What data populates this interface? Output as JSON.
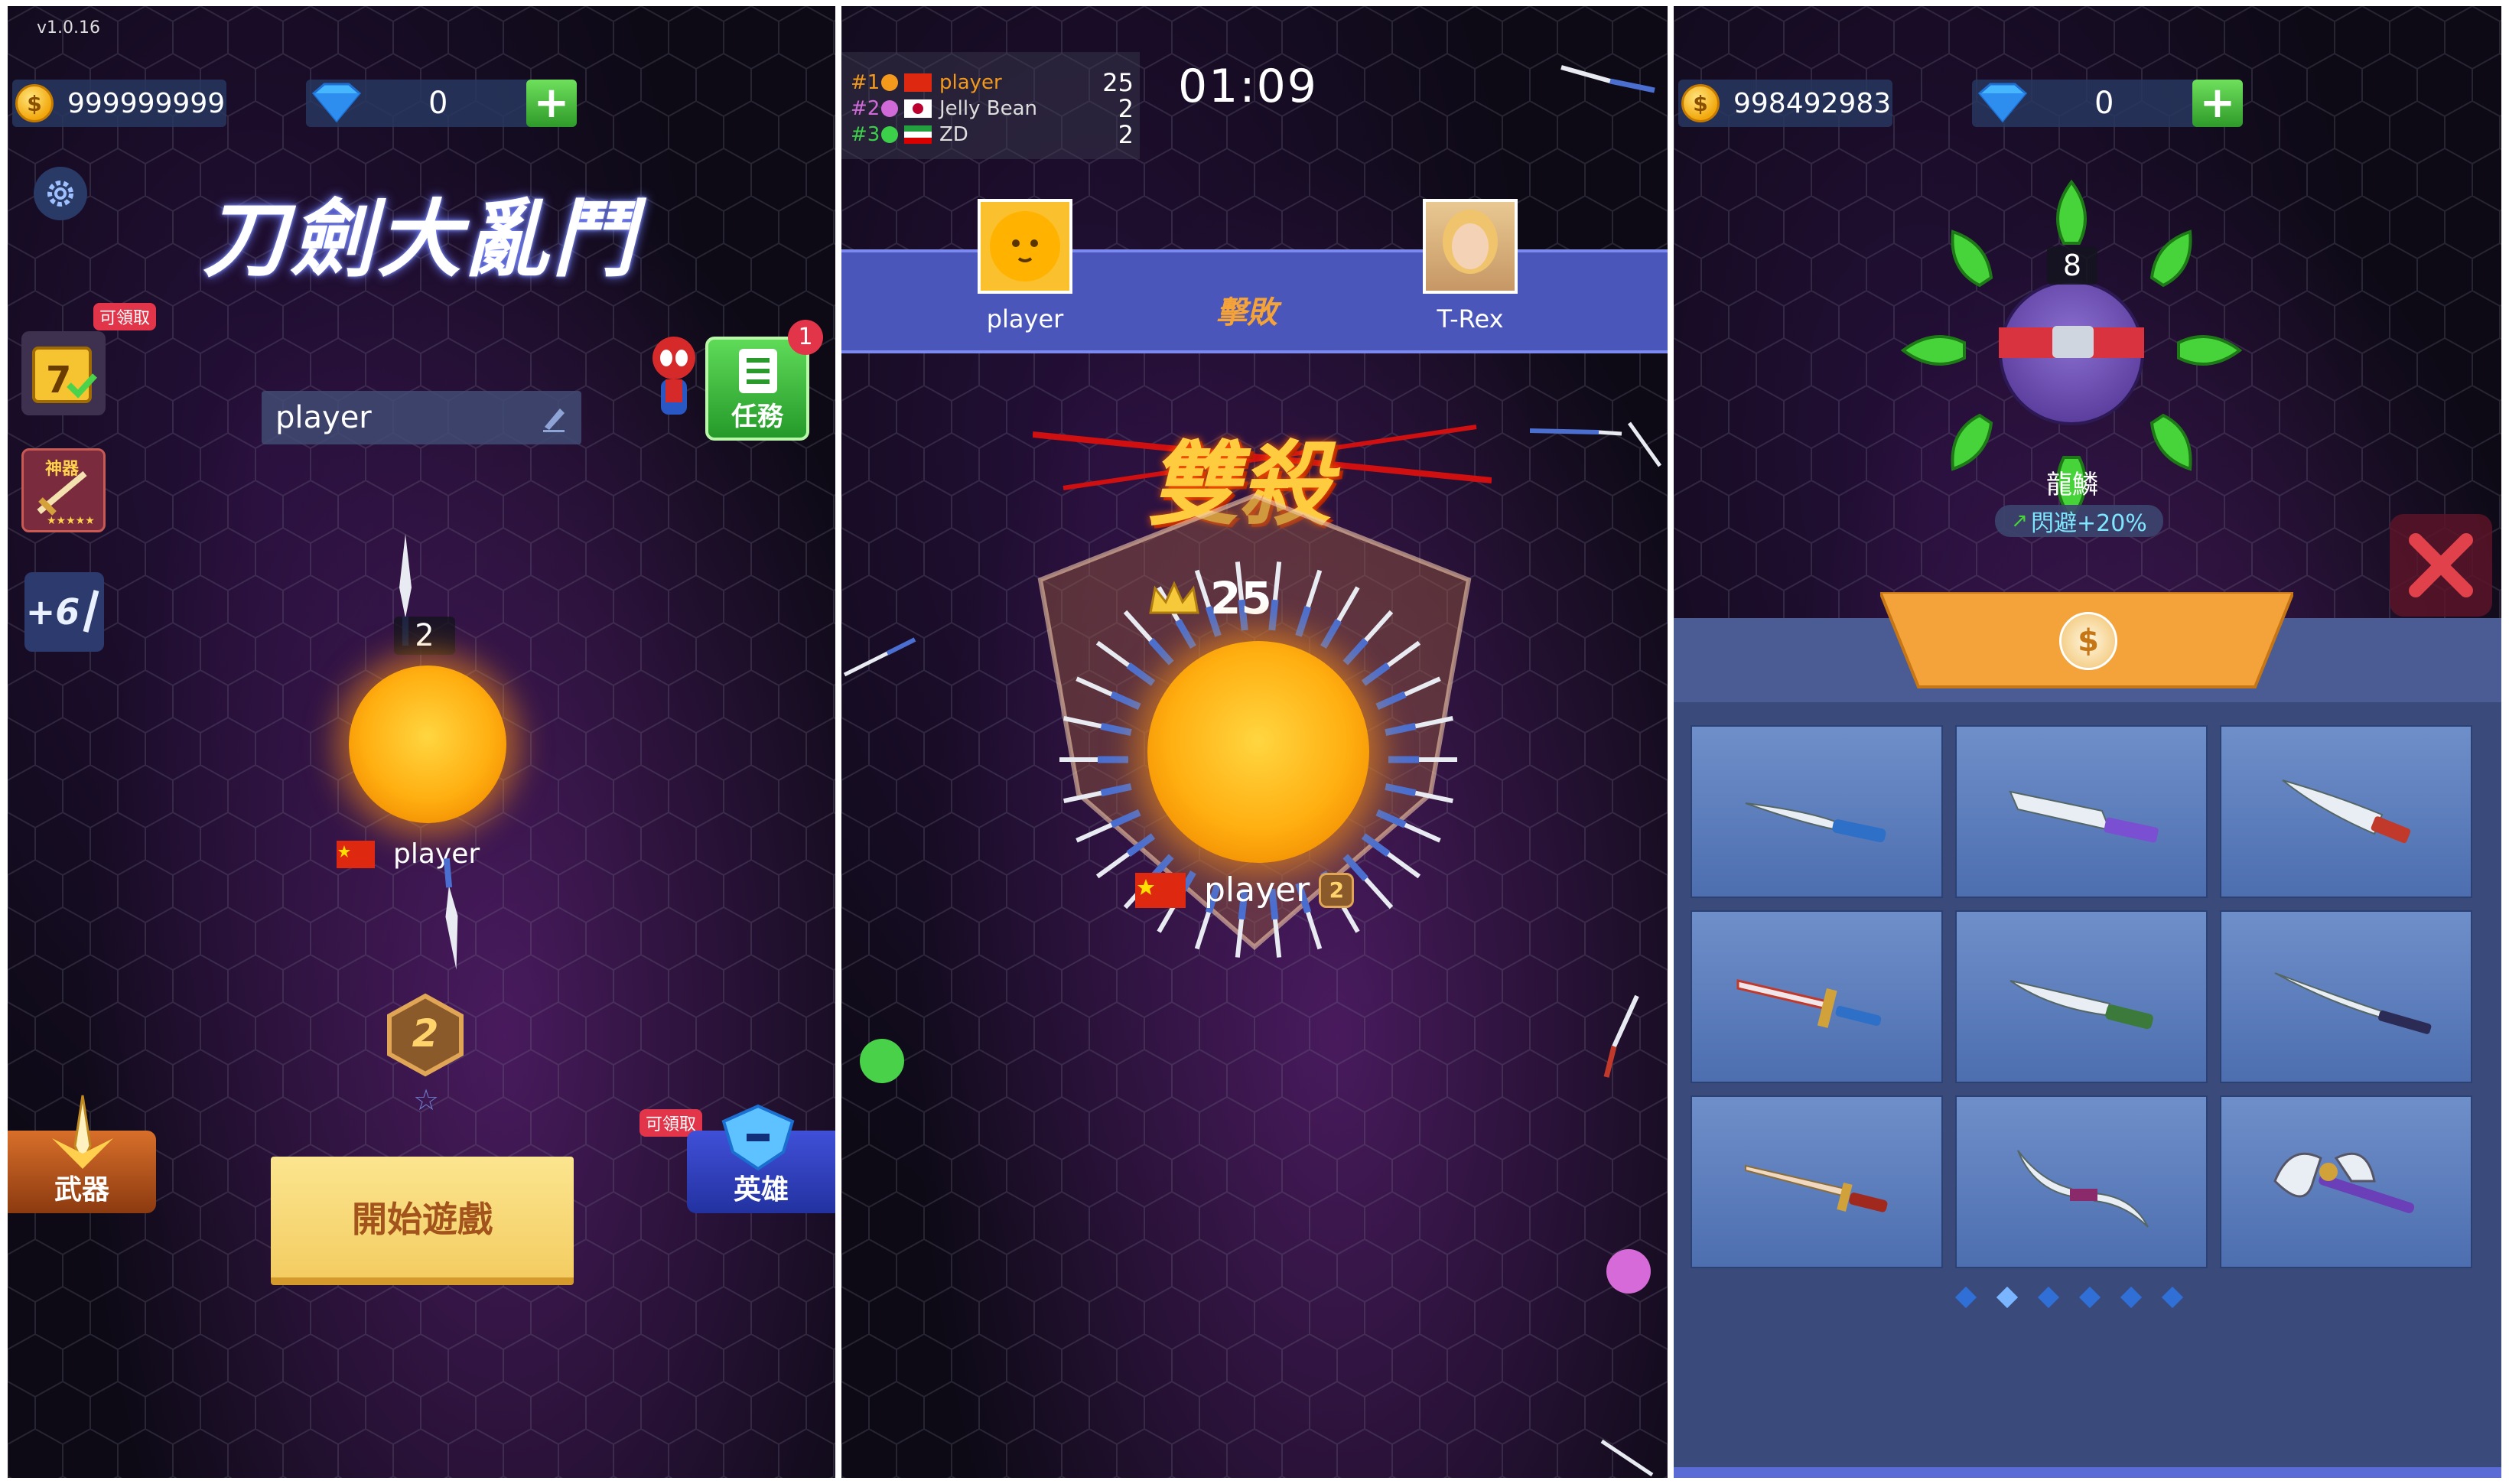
{
  "screen1": {
    "version": "v1.0.16",
    "coins": "999999999",
    "gems": "0",
    "title": "刀劍大亂鬥",
    "player_name_input": "player",
    "claimable_badge_1": "可領取",
    "mission_label": "任務",
    "mission_badge": "1",
    "artifact_label": "神器",
    "plus_label": "+6",
    "knife_count": "2",
    "player_label": "player",
    "rank_badge": "2",
    "weapon_label": "武器",
    "start_button": "開始遊戲",
    "claimable_badge_2": "可領取",
    "hero_label": "英雄"
  },
  "screen2": {
    "leaderboard": [
      {
        "rank": "#1",
        "name": "player",
        "score": "25",
        "color": "#f39a1c"
      },
      {
        "rank": "#2",
        "name": "Jelly Bean",
        "score": "2",
        "color": "#d06ad9"
      },
      {
        "rank": "#3",
        "name": "ZD",
        "score": "2",
        "color": "#3ccf49"
      }
    ],
    "timer": "01:09",
    "kill_left": "player",
    "kill_action": "擊敗",
    "kill_right": "T-Rex",
    "combo_text": "雙殺",
    "score": "25",
    "player_label": "player",
    "rank_badge": "2"
  },
  "screen3": {
    "coins": "998492983",
    "gems": "0",
    "hero_knife_count": "8",
    "hero_name": "龍鱗",
    "hero_bonus": "閃避+20%",
    "shop_tab_icon": "$",
    "weapons": [
      "kitchen-knife",
      "tanto",
      "cleaver-knife",
      "ornate-sword",
      "bowie-knife",
      "katana",
      "dagger",
      "double-blade",
      "battle-axe"
    ],
    "page_dots": 6,
    "active_page": 1
  },
  "colors": {
    "accent_orange": "#f4a23a",
    "shop_panel": "#3a4a7a",
    "start_button": "#f7d774",
    "close_red": "#d8333f"
  }
}
